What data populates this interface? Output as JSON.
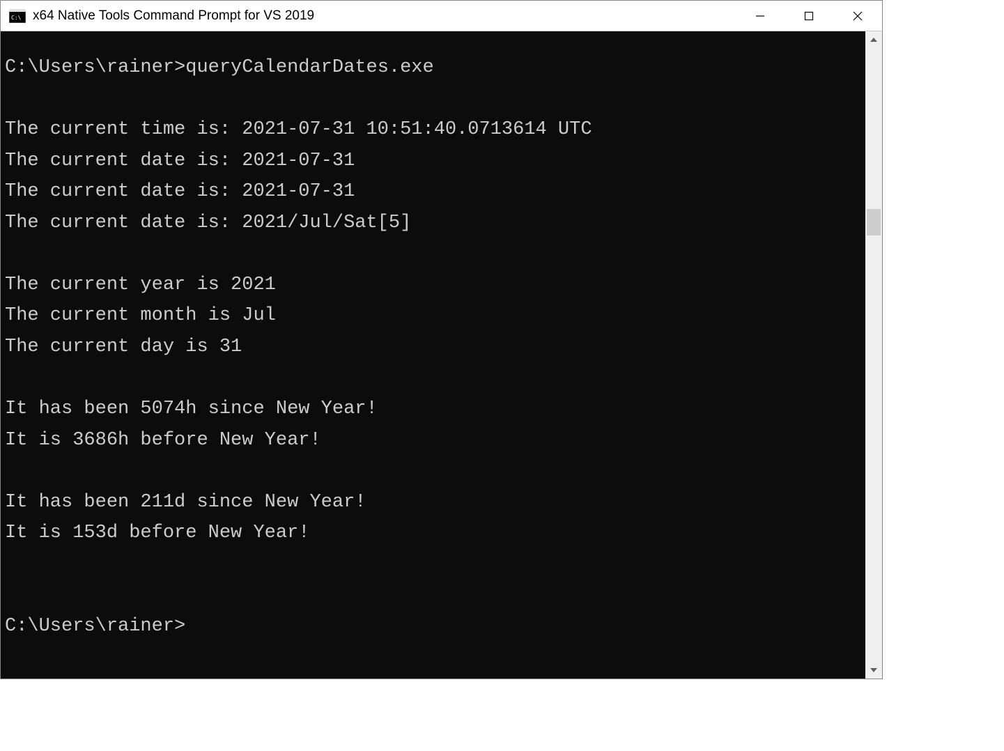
{
  "window": {
    "title": "x64 Native Tools Command Prompt for VS 2019"
  },
  "terminal": {
    "prompt1_path": "C:\\Users\\rainer>",
    "command1": "queryCalendarDates.exe",
    "blank1": "",
    "line_time": "The current time is: 2021-07-31 10:51:40.0713614 UTC",
    "line_date1": "The current date is: 2021-07-31",
    "line_date2": "The current date is: 2021-07-31",
    "line_date3": "The current date is: 2021/Jul/Sat[5]",
    "blank2": "",
    "line_year": "The current year is 2021",
    "line_month": "The current month is Jul",
    "line_day": "The current day is 31",
    "blank3": "",
    "line_hours_since": "It has been 5074h since New Year!",
    "line_hours_before": "It is 3686h before New Year!",
    "blank4": "",
    "line_days_since": "It has been 211d since New Year!",
    "line_days_before": "It is 153d before New Year!",
    "blank5": "",
    "blank6": "",
    "prompt2_path": "C:\\Users\\rainer>"
  }
}
